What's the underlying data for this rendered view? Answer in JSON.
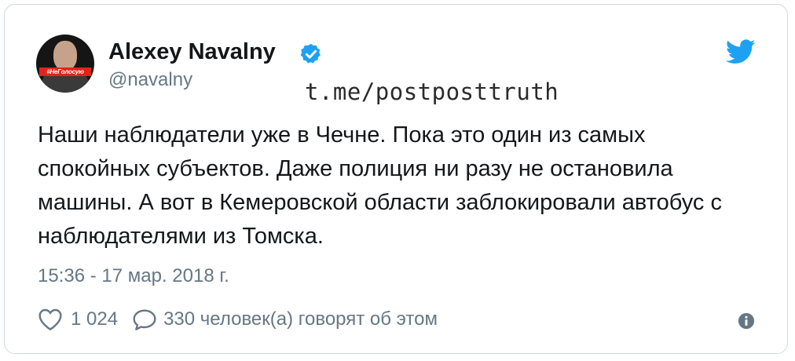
{
  "tweet": {
    "author_name": "Alexey Navalny",
    "handle": "@navalny",
    "avatar_tag": "#НеГолосую",
    "text": "Наши наблюдатели уже в Чечне. Пока это один из самых спокойных субъектов. Даже полиция ни разу не остановила машины. А вот в Кемеровской области заблокировали автобус с наблюдателями из Томска.",
    "timestamp": "15:36 - 17 мар. 2018 г.",
    "likes": "1 024",
    "replies": "330 человек(а) говорят об этом"
  },
  "watermark": "t.me/postposttruth",
  "icons": {
    "verified": "verified-badge-icon",
    "brand": "twitter-bird-icon",
    "like": "heart-icon",
    "reply": "comment-bubble-icon",
    "info": "info-icon"
  },
  "colors": {
    "brand_blue": "#1da1f2",
    "text": "#14171a",
    "secondary_text": "#657786",
    "border": "#cfd9de"
  }
}
